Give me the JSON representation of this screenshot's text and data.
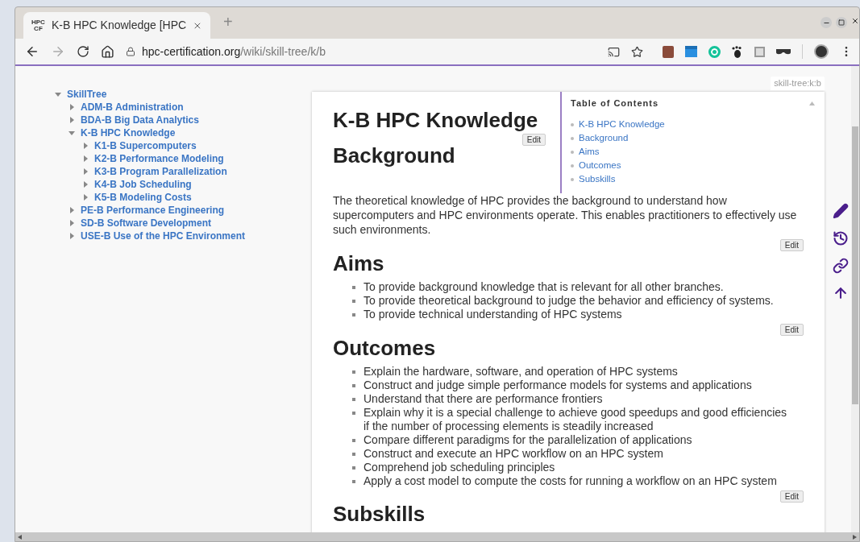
{
  "browser": {
    "favicon": [
      "HPC",
      "CF"
    ],
    "tab_title": "K-B HPC Knowledge [HPC",
    "new_tab": "+",
    "url_host": "hpc-certification.org",
    "url_path": "/wiki/skill-tree/k/b"
  },
  "tree": {
    "label": "SkillTree",
    "expanded": true,
    "children": [
      {
        "label": "ADM-B Administration",
        "expanded": false
      },
      {
        "label": "BDA-B Big Data Analytics",
        "expanded": false
      },
      {
        "label": "K-B HPC Knowledge",
        "expanded": true,
        "children": [
          {
            "label": "K1-B Supercomputers",
            "expanded": false
          },
          {
            "label": "K2-B Performance Modeling",
            "expanded": false
          },
          {
            "label": "K3-B Program Parallelization",
            "expanded": false
          },
          {
            "label": "K4-B Job Scheduling",
            "expanded": false
          },
          {
            "label": "K5-B Modeling Costs",
            "expanded": false
          }
        ]
      },
      {
        "label": "PE-B Performance Engineering",
        "expanded": false
      },
      {
        "label": "SD-B Software Development",
        "expanded": false
      },
      {
        "label": "USE-B Use of the HPC Environment",
        "expanded": false
      }
    ]
  },
  "page": {
    "namespace": "skill-tree:k:b",
    "toc": {
      "title": "Table of Contents",
      "items": [
        "K-B HPC Knowledge",
        "Background",
        "Aims",
        "Outcomes",
        "Subskills"
      ]
    },
    "sections": [
      {
        "kind": "title",
        "heading": "K-B HPC Knowledge",
        "edit": "Edit"
      },
      {
        "kind": "text",
        "heading": "Background",
        "text": "The theoretical knowledge of HPC provides the background to understand how supercomputers and HPC environments operate. This enables practitioners to effectively use such environments.",
        "edit": "Edit"
      },
      {
        "kind": "list",
        "heading": "Aims",
        "items": [
          "To provide background knowledge that is relevant for all other branches.",
          "To provide theoretical background to judge the behavior and efficiency of systems.",
          "To provide technical understanding of HPC systems"
        ],
        "edit": "Edit"
      },
      {
        "kind": "list",
        "heading": "Outcomes",
        "items": [
          "Explain the hardware, software, and operation of HPC systems",
          "Construct and judge simple performance models for systems and applications",
          "Understand that there are performance frontiers",
          "Explain why it is a special challenge to achieve good speedups and good efficiencies if the number of processing elements is steadily increased",
          "Compare different paradigms for the parallelization of applications",
          "Construct and execute an HPC workflow on an HPC system",
          "Comprehend job scheduling principles",
          "Apply a cost model to compute the costs for running a workflow on an HPC system"
        ],
        "edit": "Edit"
      },
      {
        "kind": "heading",
        "heading": "Subskills"
      }
    ]
  }
}
